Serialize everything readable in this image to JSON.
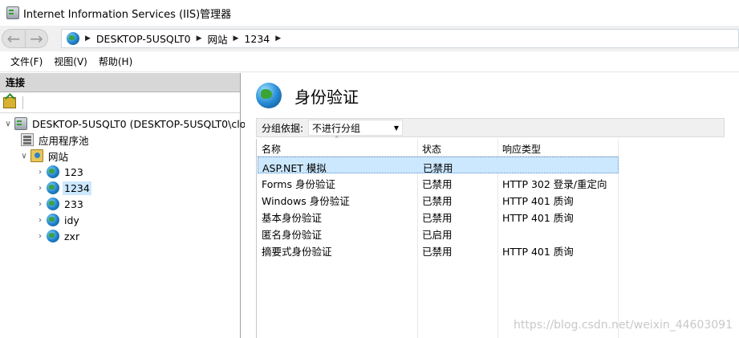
{
  "window": {
    "title": "Internet Information Services (IIS)管理器"
  },
  "address": {
    "crumbs": [
      "DESKTOP-5USQLT0",
      "网站",
      "1234"
    ]
  },
  "menu": {
    "file": "文件(F)",
    "view": "视图(V)",
    "help": "帮助(H)"
  },
  "connections": {
    "header": "连接",
    "tree": {
      "server": "DESKTOP-5USQLT0 (DESKTOP-5USQLT0\\clo",
      "app_pools": "应用程序池",
      "sites": "网站",
      "site_items": [
        "123",
        "1234",
        "233",
        "idy",
        "zxr"
      ],
      "selected_site": "1234"
    }
  },
  "feature": {
    "title": "身份验证",
    "group_by_label": "分组依据:",
    "group_by_value": "不进行分组",
    "columns": [
      "名称",
      "状态",
      "响应类型"
    ],
    "rows": [
      {
        "name": "ASP.NET 模拟",
        "status": "已禁用",
        "response": ""
      },
      {
        "name": "Forms 身份验证",
        "status": "已禁用",
        "response": "HTTP 302 登录/重定向"
      },
      {
        "name": "Windows 身份验证",
        "status": "已禁用",
        "response": "HTTP 401 质询"
      },
      {
        "name": "基本身份验证",
        "status": "已禁用",
        "response": "HTTP 401 质询"
      },
      {
        "name": "匿名身份验证",
        "status": "已启用",
        "response": ""
      },
      {
        "name": "摘要式身份验证",
        "status": "已禁用",
        "response": "HTTP 401 质询"
      }
    ],
    "selected_row": 0
  },
  "watermark": "https://blog.csdn.net/weixin_44603091"
}
